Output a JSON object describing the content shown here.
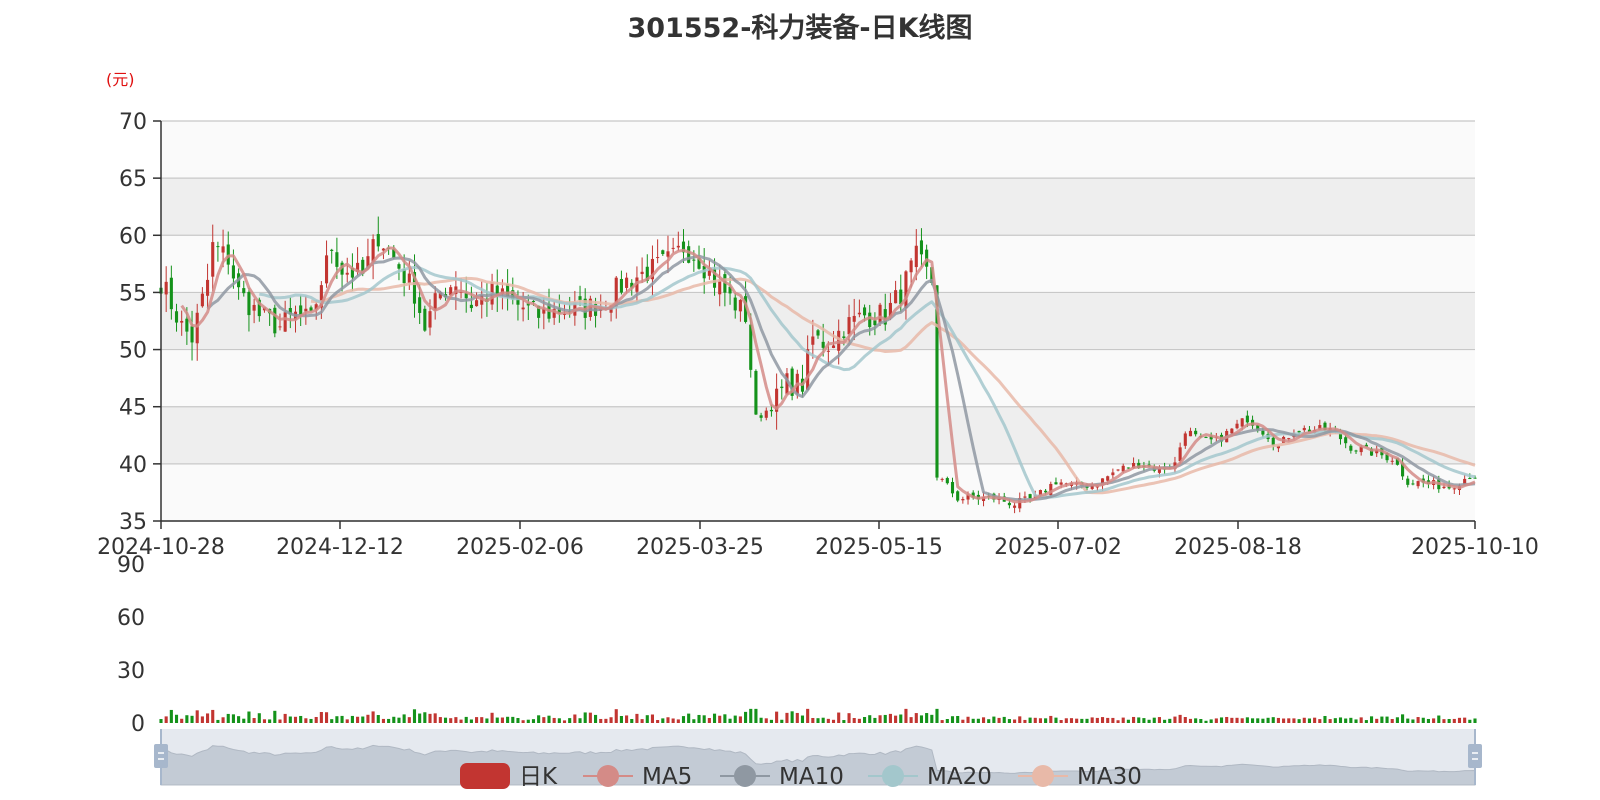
{
  "title": "301552-科力装备-日K线图",
  "unit_label": "(元)",
  "colors": {
    "up": "#c23531",
    "down": "#14921a",
    "ma5": "#d48b87",
    "ma10": "#8f98a2",
    "ma20": "#a3c7cc",
    "ma30": "#e8b9a8",
    "grid_band": "#eeeeee",
    "grid_band_alt": "#fafafa",
    "grid_line": "#c8c8c8",
    "slider_fill": "#d3dae5",
    "slider_handle": "#a7b7cc"
  },
  "chart_data": {
    "type": "candlestick",
    "title": "301552-科力装备-日K线图",
    "ylabel": "(元)",
    "ylim": [
      35,
      70
    ],
    "yticks": [
      35,
      40,
      45,
      50,
      55,
      60,
      65,
      70
    ],
    "xticks": [
      "2024-10-28",
      "2024-12-12",
      "2025-02-06",
      "2025-03-25",
      "2025-05-15",
      "2025-07-02",
      "2025-08-18",
      "2025-10-10"
    ],
    "legend": [
      "日K",
      "MA5",
      "MA10",
      "MA20",
      "MA30"
    ],
    "legend_position": "bottom",
    "grid": true,
    "price_keypoints": [
      [
        "2024-10-28",
        56
      ],
      [
        "2024-11-01",
        52
      ],
      [
        "2024-11-05",
        51
      ],
      [
        "2024-11-08",
        56
      ],
      [
        "2024-11-11",
        59
      ],
      [
        "2024-11-14",
        58
      ],
      [
        "2024-11-18",
        55
      ],
      [
        "2024-11-22",
        53
      ],
      [
        "2024-11-28",
        52
      ],
      [
        "2024-12-03",
        53
      ],
      [
        "2024-12-06",
        52.5
      ],
      [
        "2024-12-10",
        56
      ],
      [
        "2024-12-12",
        59
      ],
      [
        "2024-12-16",
        57
      ],
      [
        "2024-12-20",
        56.5
      ],
      [
        "2024-12-25",
        60
      ],
      [
        "2024-12-30",
        58
      ],
      [
        "2025-01-03",
        55
      ],
      [
        "2025-01-07",
        52
      ],
      [
        "2025-01-10",
        55
      ],
      [
        "2025-01-15",
        56
      ],
      [
        "2025-01-20",
        54
      ],
      [
        "2025-01-24",
        55
      ],
      [
        "2025-02-06",
        53
      ],
      [
        "2025-02-12",
        53.5
      ],
      [
        "2025-02-18",
        53.5
      ],
      [
        "2025-02-24",
        54
      ],
      [
        "2025-03-03",
        56
      ],
      [
        "2025-03-10",
        57
      ],
      [
        "2025-03-14",
        58
      ],
      [
        "2025-03-18",
        59
      ],
      [
        "2025-03-21",
        58
      ],
      [
        "2025-03-26",
        56
      ],
      [
        "2025-04-01",
        54
      ],
      [
        "2025-04-03",
        53
      ],
      [
        "2025-04-07",
        44
      ],
      [
        "2025-04-10",
        45
      ],
      [
        "2025-04-15",
        47
      ],
      [
        "2025-04-18",
        47
      ],
      [
        "2025-04-22",
        51
      ],
      [
        "2025-04-25",
        50.5
      ],
      [
        "2025-04-30",
        52
      ],
      [
        "2025-05-06",
        53
      ],
      [
        "2025-05-12",
        53
      ],
      [
        "2025-05-15",
        55
      ],
      [
        "2025-05-20",
        58
      ],
      [
        "2025-05-23",
        56
      ],
      [
        "2025-05-26",
        39
      ],
      [
        "2025-05-30",
        37
      ],
      [
        "2025-06-05",
        37
      ],
      [
        "2025-06-10",
        37
      ],
      [
        "2025-06-16",
        36.5
      ],
      [
        "2025-06-20",
        37
      ],
      [
        "2025-06-26",
        38.5
      ],
      [
        "2025-07-02",
        38
      ],
      [
        "2025-07-08",
        38.3
      ],
      [
        "2025-07-14",
        39.5
      ],
      [
        "2025-07-18",
        40
      ],
      [
        "2025-07-24",
        39.5
      ],
      [
        "2025-07-29",
        40
      ],
      [
        "2025-07-31",
        43
      ],
      [
        "2025-08-05",
        42
      ],
      [
        "2025-08-08",
        42
      ],
      [
        "2025-08-13",
        43
      ],
      [
        "2025-08-18",
        44
      ],
      [
        "2025-08-22",
        42.5
      ],
      [
        "2025-08-26",
        41.5
      ],
      [
        "2025-08-29",
        43
      ],
      [
        "2025-09-04",
        43
      ],
      [
        "2025-09-09",
        43
      ],
      [
        "2025-09-15",
        41.5
      ],
      [
        "2025-09-19",
        41
      ],
      [
        "2025-09-25",
        40.5
      ],
      [
        "2025-09-30",
        38.5
      ],
      [
        "2025-10-10",
        38
      ],
      [
        "2025-10-16",
        39
      ]
    ],
    "volume": {
      "ylim": [
        0,
        90
      ],
      "yticks": [
        0,
        30,
        60,
        90
      ]
    }
  }
}
